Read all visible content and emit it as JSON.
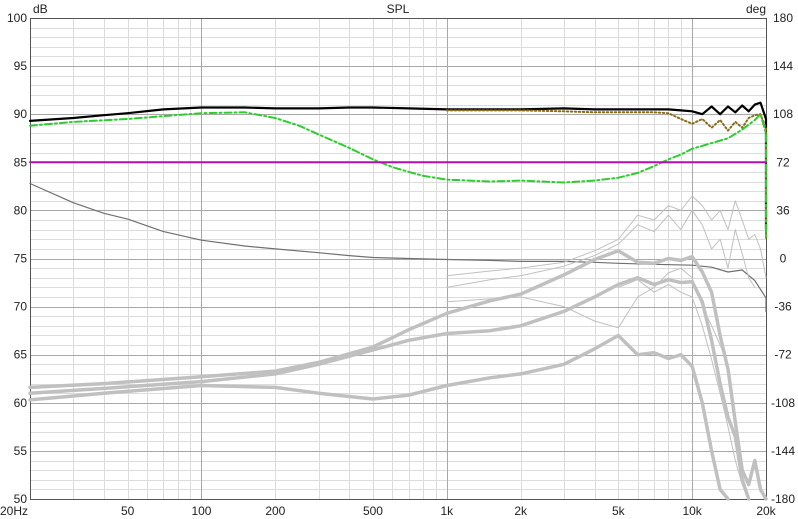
{
  "chart_data": {
    "type": "line",
    "title": "SPL",
    "ylabel_left": "dB",
    "ylabel_right": "deg",
    "x_scale": "log",
    "xlim": [
      20,
      20000
    ],
    "ylim_left": [
      50,
      100
    ],
    "ylim_right": [
      -180,
      180
    ],
    "grid": true,
    "x_ticks": [
      {
        "v": 20,
        "label": "20Hz"
      },
      {
        "v": 50,
        "label": "50"
      },
      {
        "v": 100,
        "label": "100"
      },
      {
        "v": 200,
        "label": "200"
      },
      {
        "v": 500,
        "label": "500"
      },
      {
        "v": 1000,
        "label": "1k"
      },
      {
        "v": 2000,
        "label": "2k"
      },
      {
        "v": 5000,
        "label": "5k"
      },
      {
        "v": 10000,
        "label": "10k"
      },
      {
        "v": 20000,
        "label": "20k"
      }
    ],
    "y_ticks_left": [
      "100",
      "95",
      "90",
      "85",
      "80",
      "75",
      "70",
      "65",
      "60",
      "55",
      "50"
    ],
    "y_ticks_right": [
      "180",
      "144",
      "108",
      "72",
      "36",
      "0",
      "-36",
      "-72",
      "-108",
      "-144",
      "-180"
    ],
    "series": [
      {
        "color": "#000000",
        "style": "solid",
        "width": 2.2,
        "axis": "left",
        "points": [
          [
            20,
            89.3
          ],
          [
            30,
            89.6
          ],
          [
            40,
            89.9
          ],
          [
            50,
            90.1
          ],
          [
            70,
            90.5
          ],
          [
            100,
            90.7
          ],
          [
            150,
            90.7
          ],
          [
            200,
            90.6
          ],
          [
            300,
            90.6
          ],
          [
            400,
            90.7
          ],
          [
            500,
            90.7
          ],
          [
            700,
            90.6
          ],
          [
            1000,
            90.5
          ],
          [
            1500,
            90.5
          ],
          [
            2000,
            90.5
          ],
          [
            3000,
            90.6
          ],
          [
            4000,
            90.5
          ],
          [
            5000,
            90.5
          ],
          [
            7000,
            90.5
          ],
          [
            8000,
            90.5
          ],
          [
            9000,
            90.4
          ],
          [
            10000,
            90.3
          ],
          [
            11000,
            90.0
          ],
          [
            12000,
            90.8
          ],
          [
            13000,
            90.0
          ],
          [
            14000,
            90.8
          ],
          [
            15000,
            90.2
          ],
          [
            16000,
            90.9
          ],
          [
            17000,
            90.3
          ],
          [
            18000,
            91.0
          ],
          [
            19000,
            91.2
          ],
          [
            20000,
            89.5
          ],
          [
            21000,
            85.5
          ],
          [
            22000,
            81.0
          ],
          [
            23000,
            78.0
          ]
        ]
      },
      {
        "color": "#8a6d1a",
        "style": "dotted",
        "width": 2,
        "axis": "left",
        "points": [
          [
            1000,
            90.4
          ],
          [
            2000,
            90.4
          ],
          [
            3000,
            90.3
          ],
          [
            4000,
            90.2
          ],
          [
            5000,
            90.2
          ],
          [
            7000,
            90.2
          ],
          [
            8000,
            90.1
          ],
          [
            9000,
            89.5
          ],
          [
            10000,
            89.0
          ],
          [
            11000,
            89.5
          ],
          [
            12000,
            88.6
          ],
          [
            13000,
            89.4
          ],
          [
            14000,
            88.3
          ],
          [
            15000,
            89.2
          ],
          [
            16000,
            88.6
          ],
          [
            17000,
            89.6
          ],
          [
            18000,
            89.9
          ],
          [
            19000,
            90.0
          ],
          [
            20000,
            88.5
          ],
          [
            21000,
            84.5
          ],
          [
            22000,
            80.0
          ],
          [
            23000,
            77.0
          ]
        ]
      },
      {
        "color": "#2ecc2e",
        "style": "dashdot",
        "width": 2,
        "axis": "left",
        "points": [
          [
            20,
            88.8
          ],
          [
            30,
            89.2
          ],
          [
            50,
            89.5
          ],
          [
            70,
            89.8
          ],
          [
            100,
            90.1
          ],
          [
            150,
            90.2
          ],
          [
            200,
            89.6
          ],
          [
            250,
            88.8
          ],
          [
            300,
            87.9
          ],
          [
            400,
            86.5
          ],
          [
            500,
            85.3
          ],
          [
            600,
            84.5
          ],
          [
            700,
            84.0
          ],
          [
            800,
            83.6
          ],
          [
            1000,
            83.2
          ],
          [
            1500,
            83.0
          ],
          [
            2000,
            83.1
          ],
          [
            3000,
            82.9
          ],
          [
            4000,
            83.1
          ],
          [
            5000,
            83.4
          ],
          [
            6000,
            83.9
          ],
          [
            7000,
            84.6
          ],
          [
            8000,
            85.3
          ],
          [
            9000,
            85.8
          ],
          [
            10000,
            86.4
          ],
          [
            12000,
            87.0
          ],
          [
            14000,
            87.5
          ],
          [
            16000,
            88.4
          ],
          [
            18000,
            89.4
          ],
          [
            19000,
            90.0
          ],
          [
            20000,
            88.0
          ],
          [
            21000,
            84.0
          ],
          [
            22000,
            79.5
          ],
          [
            23000,
            77.0
          ]
        ]
      },
      {
        "color": "#b40fb4",
        "style": "solid",
        "width": 2,
        "axis": "left",
        "points": [
          [
            20,
            85
          ],
          [
            23000,
            85
          ]
        ]
      },
      {
        "color": "#707070",
        "style": "solid",
        "width": 1.2,
        "axis": "left",
        "points": [
          [
            20,
            82.8
          ],
          [
            30,
            80.8
          ],
          [
            40,
            79.7
          ],
          [
            50,
            79.1
          ],
          [
            70,
            77.8
          ],
          [
            100,
            76.9
          ],
          [
            150,
            76.3
          ],
          [
            200,
            76.0
          ],
          [
            300,
            75.6
          ],
          [
            400,
            75.3
          ],
          [
            500,
            75.1
          ],
          [
            700,
            75.0
          ],
          [
            1000,
            74.9
          ],
          [
            1500,
            74.8
          ],
          [
            2000,
            74.7
          ],
          [
            3000,
            74.7
          ],
          [
            4000,
            74.6
          ],
          [
            5000,
            74.5
          ],
          [
            7000,
            74.4
          ],
          [
            10000,
            74.3
          ],
          [
            12000,
            74.1
          ],
          [
            14000,
            73.6
          ],
          [
            16000,
            73.8
          ],
          [
            18000,
            72.7
          ],
          [
            20000,
            70.9
          ],
          [
            23000,
            69.5
          ]
        ]
      },
      {
        "color": "#c0c0c0",
        "style": "solid",
        "width": 3.5,
        "axis": "left",
        "points": [
          [
            20,
            61.6
          ],
          [
            40,
            62.0
          ],
          [
            100,
            62.7
          ],
          [
            200,
            63.3
          ],
          [
            300,
            64.2
          ],
          [
            500,
            65.8
          ],
          [
            700,
            67.6
          ],
          [
            1000,
            69.3
          ],
          [
            1500,
            70.6
          ],
          [
            2000,
            71.3
          ],
          [
            3000,
            73.3
          ],
          [
            4000,
            74.9
          ],
          [
            5000,
            75.8
          ],
          [
            6000,
            74.6
          ],
          [
            7000,
            74.5
          ],
          [
            8000,
            75.0
          ],
          [
            9000,
            74.8
          ],
          [
            10000,
            75.2
          ],
          [
            11000,
            73.6
          ],
          [
            12000,
            71.5
          ],
          [
            13000,
            67.0
          ],
          [
            14000,
            63.5
          ],
          [
            15000,
            58.0
          ],
          [
            16000,
            53.0
          ],
          [
            17000,
            51.5
          ],
          [
            18000,
            54.0
          ],
          [
            19000,
            51.0
          ],
          [
            20000,
            50.0
          ]
        ]
      },
      {
        "color": "#c0c0c0",
        "style": "solid",
        "width": 3.5,
        "axis": "left",
        "points": [
          [
            20,
            61.0
          ],
          [
            40,
            61.5
          ],
          [
            100,
            62.2
          ],
          [
            200,
            63.0
          ],
          [
            300,
            64.0
          ],
          [
            500,
            65.5
          ],
          [
            700,
            66.5
          ],
          [
            1000,
            67.2
          ],
          [
            1500,
            67.5
          ],
          [
            2000,
            68.0
          ],
          [
            3000,
            69.5
          ],
          [
            4000,
            71.0
          ],
          [
            5000,
            72.3
          ],
          [
            6000,
            73.0
          ],
          [
            7000,
            72.3
          ],
          [
            8000,
            72.8
          ],
          [
            9000,
            72.5
          ],
          [
            10000,
            72.6
          ],
          [
            11000,
            70.5
          ],
          [
            12000,
            66.5
          ],
          [
            13000,
            62.0
          ],
          [
            14000,
            58.5
          ],
          [
            15000,
            56.5
          ],
          [
            16000,
            52.0
          ],
          [
            17000,
            50.0
          ]
        ]
      },
      {
        "color": "#c0c0c0",
        "style": "solid",
        "width": 3.5,
        "axis": "left",
        "points": [
          [
            20,
            60.3
          ],
          [
            40,
            61.0
          ],
          [
            100,
            61.8
          ],
          [
            200,
            61.6
          ],
          [
            300,
            61.0
          ],
          [
            500,
            60.4
          ],
          [
            700,
            60.8
          ],
          [
            1000,
            61.8
          ],
          [
            1500,
            62.6
          ],
          [
            2000,
            63.0
          ],
          [
            3000,
            64.0
          ],
          [
            4000,
            65.6
          ],
          [
            5000,
            67.0
          ],
          [
            6000,
            65.0
          ],
          [
            7000,
            65.2
          ],
          [
            8000,
            64.6
          ],
          [
            9000,
            65.0
          ],
          [
            10000,
            63.8
          ],
          [
            11000,
            60.0
          ],
          [
            12000,
            55.0
          ],
          [
            13000,
            51.0
          ],
          [
            14000,
            50.0
          ]
        ]
      },
      {
        "color": "#c0c0c0",
        "style": "solid",
        "width": 1,
        "axis": "left",
        "points": [
          [
            1000,
            73.2
          ],
          [
            1500,
            73.7
          ],
          [
            2000,
            74.0
          ],
          [
            3000,
            74.6
          ],
          [
            4000,
            75.8
          ],
          [
            5000,
            77.0
          ],
          [
            6000,
            79.5
          ],
          [
            7000,
            79.0
          ],
          [
            8000,
            80.5
          ],
          [
            9000,
            80.0
          ],
          [
            10000,
            81.5
          ],
          [
            11000,
            80.5
          ],
          [
            12000,
            79.0
          ],
          [
            13000,
            80.0
          ],
          [
            14000,
            78.0
          ],
          [
            15000,
            81.0
          ],
          [
            16000,
            79.0
          ],
          [
            17000,
            77.0
          ],
          [
            18000,
            77.5
          ],
          [
            19000,
            76.0
          ],
          [
            20000,
            73.0
          ]
        ]
      },
      {
        "color": "#c0c0c0",
        "style": "solid",
        "width": 1,
        "axis": "left",
        "points": [
          [
            1000,
            72.0
          ],
          [
            1500,
            72.8
          ],
          [
            2000,
            73.2
          ],
          [
            3000,
            74.2
          ],
          [
            4000,
            75.3
          ],
          [
            5000,
            76.5
          ],
          [
            6000,
            78.5
          ],
          [
            7000,
            77.8
          ],
          [
            8000,
            79.5
          ],
          [
            9000,
            78.0
          ],
          [
            10000,
            80.0
          ],
          [
            11000,
            78.5
          ],
          [
            12000,
            76.0
          ],
          [
            13000,
            77.0
          ],
          [
            14000,
            74.0
          ],
          [
            15000,
            78.0
          ],
          [
            16000,
            75.5
          ],
          [
            17000,
            73.0
          ],
          [
            18000,
            72.0
          ]
        ]
      },
      {
        "color": "#c0c0c0",
        "style": "solid",
        "width": 1,
        "axis": "left",
        "points": [
          [
            1000,
            70.5
          ],
          [
            1500,
            70.8
          ],
          [
            2000,
            71.0
          ],
          [
            3000,
            70.0
          ],
          [
            4000,
            68.5
          ],
          [
            5000,
            67.8
          ],
          [
            6000,
            71.0
          ],
          [
            7000,
            72.0
          ],
          [
            8000,
            73.5
          ],
          [
            9000,
            74.0
          ],
          [
            10000,
            73.0
          ],
          [
            11000,
            70.0
          ],
          [
            12000,
            68.0
          ],
          [
            13000,
            66.0
          ],
          [
            14000,
            64.0
          ]
        ]
      },
      {
        "color": "#c0c0c0",
        "style": "solid",
        "width": 1,
        "axis": "left",
        "points": [
          [
            5000,
            72.0
          ],
          [
            6000,
            72.8
          ],
          [
            7000,
            71.5
          ],
          [
            8000,
            72.3
          ],
          [
            9000,
            71.5
          ],
          [
            10000,
            71.0
          ],
          [
            11000,
            68.0
          ],
          [
            12000,
            64.5
          ],
          [
            13000,
            61.0
          ],
          [
            14000,
            57.5
          ],
          [
            15000,
            54.0
          ],
          [
            16000,
            51.5
          ],
          [
            17000,
            50.0
          ]
        ]
      }
    ]
  }
}
